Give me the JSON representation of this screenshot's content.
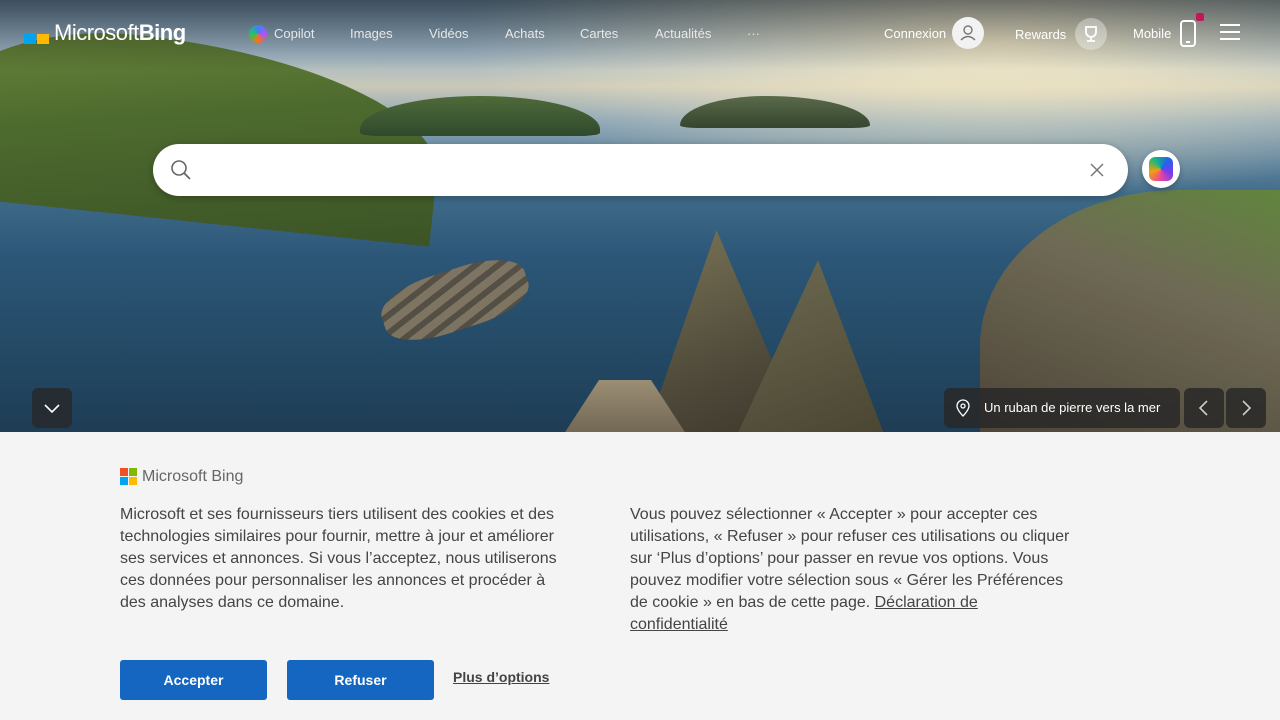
{
  "header": {
    "logo_text": "Microsoft",
    "logo_text_bing": "Bing",
    "nav": [
      "Copilot",
      "Images",
      "Vidéos",
      "Achats",
      "Cartes",
      "Actualités",
      "···"
    ],
    "sign_in": "Connexion",
    "rewards": "Rewards",
    "mobile": "Mobile"
  },
  "search": {
    "value": "",
    "placeholder": ""
  },
  "hero": {
    "caption": "Un ruban de pierre vers la mer",
    "expand_icon": "chevron-down-icon",
    "prev_icon": "chevron-left-icon",
    "next_icon": "chevron-right-icon"
  },
  "cookie": {
    "logo_text": "Microsoft Bing",
    "left_text": "Microsoft et ses fournisseurs tiers utilisent des cookies et des technologies similaires pour fournir, mettre à jour et améliorer ses services et annonces. Si vous l’acceptez, nous utiliserons ces données pour personnaliser les annonces et procéder à des analyses dans ce domaine.",
    "right_text": "Vous pouvez sélectionner « Accepter » pour accepter ces utilisations, « Refuser » pour refuser ces utilisations ou cliquer sur ‘Plus d’options’ pour passer en revue vos options. Vous pouvez modifier votre sélection sous « Gérer les Préférences de cookie » en bas de cette page. ",
    "privacy_link": "Déclaration de confidentialité",
    "accept": "Accepter",
    "refuse": "Refuser",
    "more_options": "Plus d’options"
  },
  "colors": {
    "accent_blue": "#1566c0",
    "banner_bg": "#f4f4f4",
    "notification_dot": "#c2185b"
  }
}
